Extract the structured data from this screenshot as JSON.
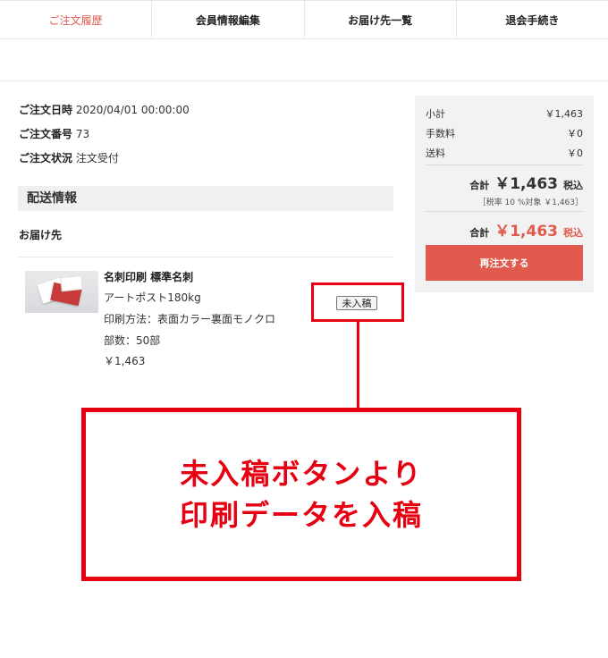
{
  "tabs": [
    {
      "label": "ご注文履歴"
    },
    {
      "label": "会員情報編集"
    },
    {
      "label": "お届け先一覧"
    },
    {
      "label": "退会手続き"
    }
  ],
  "order": {
    "date_label": "ご注文日時",
    "date_value": "2020/04/01 00:00:00",
    "number_label": "ご注文番号",
    "number_value": "73",
    "status_label": "ご注文状況",
    "status_value": "注文受付"
  },
  "shipping": {
    "section_title": "配送情報",
    "deliver_label": "お届け先"
  },
  "item": {
    "name": "名刺印刷 標準名刺",
    "paper": "アートポスト180kg",
    "method": "印刷方法：表面カラー裏面モノクロ",
    "quantity": "部数：50部",
    "price": "￥1,463",
    "upload_button": "未入稿"
  },
  "summary": {
    "subtotal_label": "小計",
    "subtotal_value": "￥1,463",
    "fee_label": "手数料",
    "fee_value": "￥0",
    "shipping_label": "送料",
    "shipping_value": "￥0",
    "total_label": "合計",
    "total_value": "￥1,463",
    "tax_incl": "税込",
    "tax_note": "［税率 10 %対象 ￥1,463］",
    "total2_label": "合計",
    "total2_value": "￥1,463",
    "tax_incl2": "税込",
    "reorder_button": "再注文する"
  },
  "callout": {
    "line1": "未入稿ボタンより",
    "line2": "印刷データを入稿"
  },
  "colors": {
    "accent": "#e05a4e",
    "annotation": "#e60012"
  }
}
